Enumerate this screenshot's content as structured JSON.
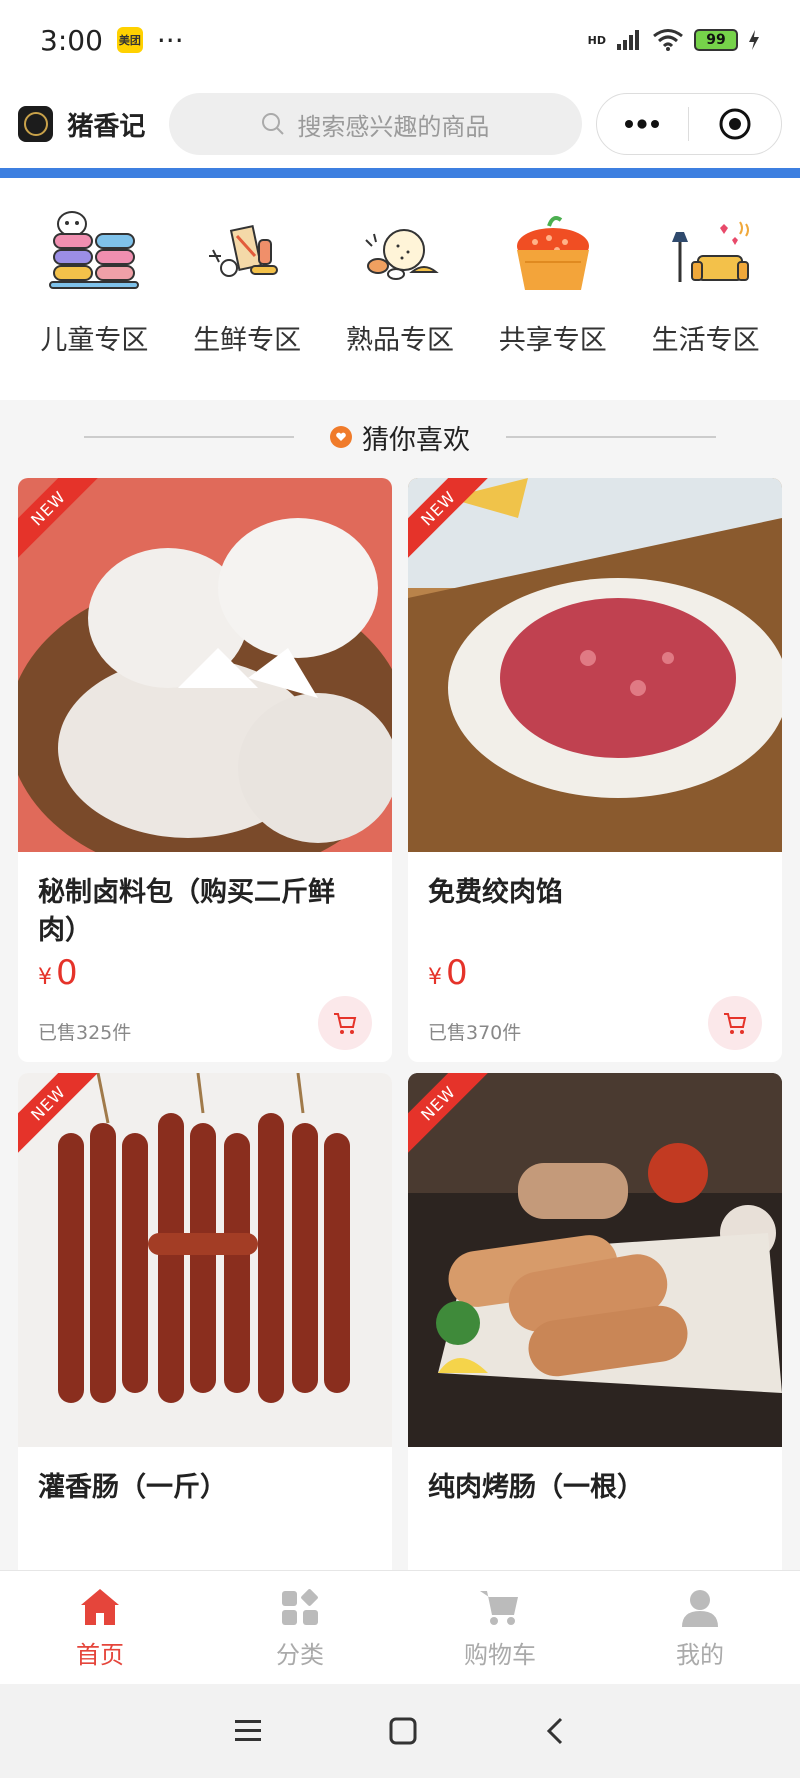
{
  "status_bar": {
    "time": "3:00",
    "app_badge": "美团",
    "more": "···",
    "battery": "99",
    "signal": "HD"
  },
  "header": {
    "shop_name": "猪香记",
    "search_placeholder": "搜索感兴趣的商品"
  },
  "categories": [
    {
      "label": "儿童专区",
      "icon": "macaron-stack-icon"
    },
    {
      "label": "生鲜专区",
      "icon": "fresh-food-icon"
    },
    {
      "label": "熟品专区",
      "icon": "cooked-food-icon"
    },
    {
      "label": "共享专区",
      "icon": "share-basket-icon"
    },
    {
      "label": "生活专区",
      "icon": "living-room-icon"
    }
  ],
  "section": {
    "title": "猜你喜欢"
  },
  "products": [
    {
      "name": "秘制卤料包（购买二斤鲜肉）",
      "currency": "¥",
      "price": "0",
      "sold": "已售325件",
      "badge": "NEW"
    },
    {
      "name": "免费绞肉馅",
      "currency": "¥",
      "price": "0",
      "sold": "已售370件",
      "badge": "NEW"
    },
    {
      "name": "灌香肠（一斤）",
      "badge": "NEW"
    },
    {
      "name": "纯肉烤肠（一根）",
      "badge": "NEW"
    }
  ],
  "tabbar": [
    {
      "label": "首页",
      "icon": "home-icon",
      "active": true
    },
    {
      "label": "分类",
      "icon": "category-icon",
      "active": false
    },
    {
      "label": "购物车",
      "icon": "cart-icon",
      "active": false
    },
    {
      "label": "我的",
      "icon": "user-icon",
      "active": false
    }
  ],
  "colors": {
    "accent": "#e5453b",
    "blue_bar": "#3d7fe0",
    "price": "#e5332a"
  }
}
